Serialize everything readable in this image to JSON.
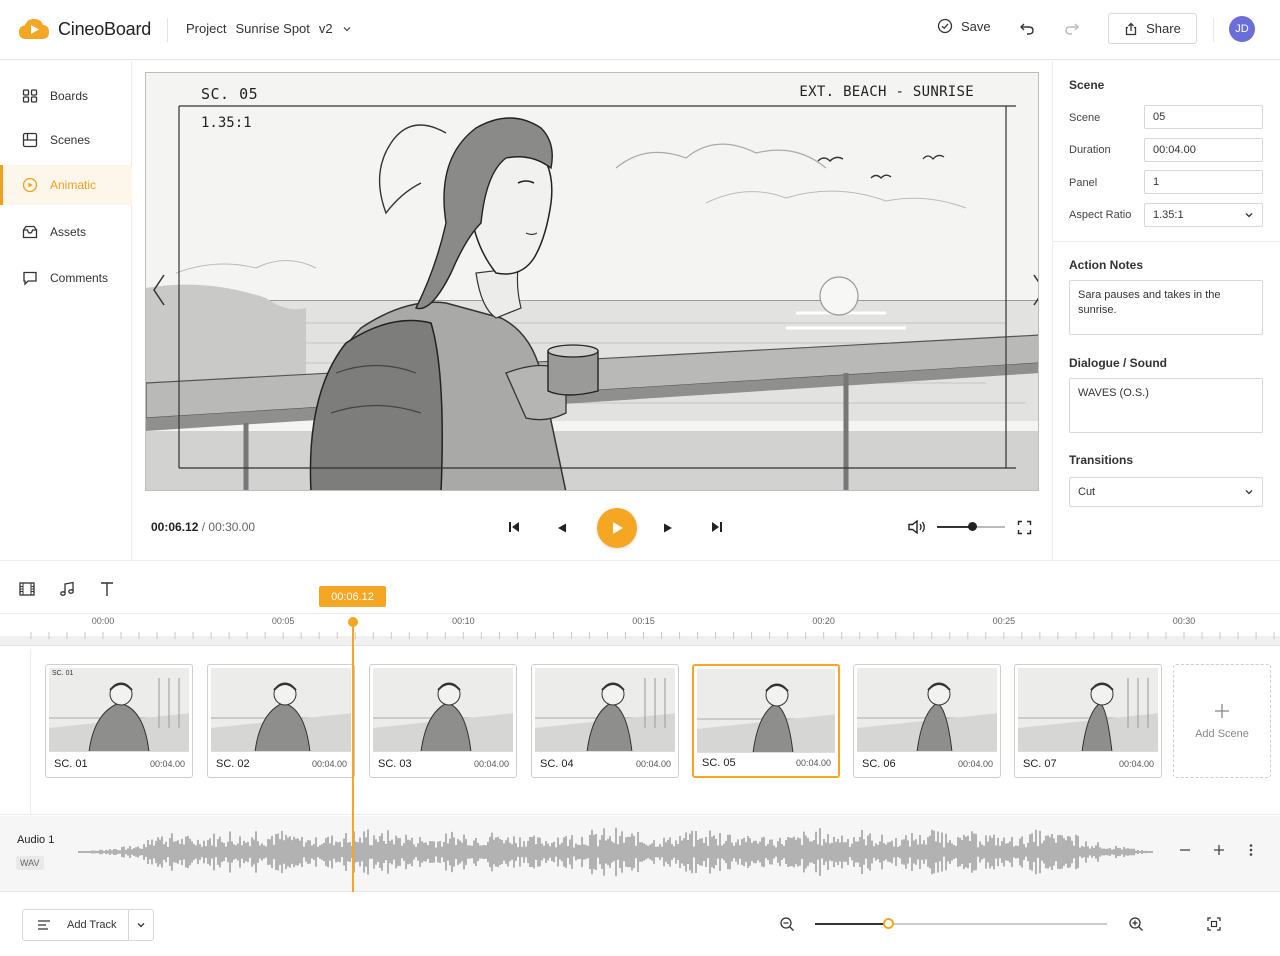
{
  "app": {
    "name": "CineoBoard"
  },
  "header": {
    "project_label": "Project",
    "project_name": "Sunrise Spot",
    "version": "v2",
    "save_label": "Save",
    "share_label": "Share",
    "avatar_initials": "JD"
  },
  "sidebar": {
    "items": [
      {
        "label": "Boards",
        "icon": "boards-icon"
      },
      {
        "label": "Scenes",
        "icon": "scenes-icon"
      },
      {
        "label": "Animatic",
        "icon": "animatic-icon",
        "active": true
      },
      {
        "label": "Assets",
        "icon": "assets-icon"
      },
      {
        "label": "Comments",
        "icon": "comments-icon"
      }
    ]
  },
  "preview": {
    "scene_label": "SC. 05",
    "aspect_label": "1.35:1",
    "location_label": "EXT. BEACH - SUNRISE"
  },
  "playback": {
    "current_time": "00:06.12",
    "total_time": "00:30.00",
    "volume": 0.52
  },
  "panel": {
    "section_title": "Scene",
    "scene_label": "Scene",
    "scene_value": "05",
    "duration_label": "Duration",
    "duration_value": "00:04.00",
    "panel_label": "Panel",
    "panel_value": "1",
    "aspect_label": "Aspect Ratio",
    "aspect_value": "1.35:1",
    "action_title": "Action Notes",
    "action_text": "Sara pauses and takes in the sunrise.",
    "dialogue_title": "Dialogue / Sound",
    "dialogue_text": "WAVES (O.S.)",
    "transitions_title": "Transitions",
    "transition_value": "Cut"
  },
  "timeline": {
    "playhead_time": "00:06.12",
    "ticks": [
      "00:00",
      "00:05",
      "00:10",
      "00:15",
      "00:20",
      "00:25",
      "00:30"
    ],
    "scenes": [
      {
        "name": "SC. 01",
        "duration": "00:04.00",
        "badge": "SC. 01"
      },
      {
        "name": "SC. 02",
        "duration": "00:04.00"
      },
      {
        "name": "SC. 03",
        "duration": "00:04.00"
      },
      {
        "name": "SC. 04",
        "duration": "00:04.00"
      },
      {
        "name": "SC. 05",
        "duration": "00:04.00",
        "selected": true
      },
      {
        "name": "SC. 06",
        "duration": "00:04.00"
      },
      {
        "name": "SC. 07",
        "duration": "00:04.00"
      }
    ],
    "add_scene_label": "Add Scene",
    "audio_track_name": "Audio 1",
    "audio_track_type": "WAV",
    "add_track_label": "Add Track",
    "zoom_level": 0.25
  },
  "colors": {
    "accent": "#f5a623",
    "avatar": "#6a6fd7"
  }
}
